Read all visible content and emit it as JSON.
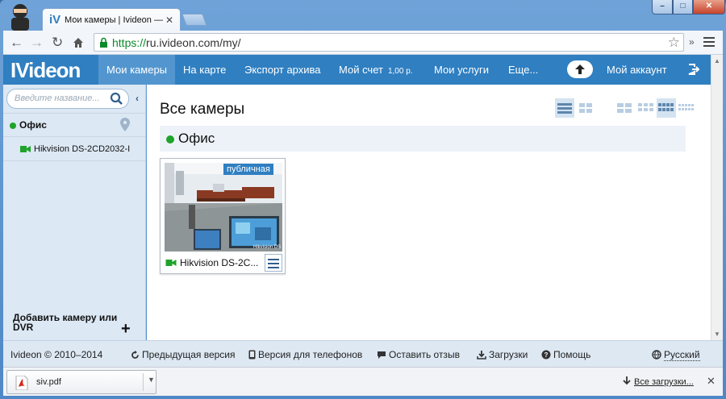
{
  "browser": {
    "tab_title": "Мои камеры | Ivideon —",
    "tab_logo": "iV",
    "tab_close": "✕",
    "url_scheme": "https://",
    "url_rest": "ru.ivideon.com/my/",
    "extensions_label": "»",
    "win_min": "–",
    "win_max": "□",
    "win_close": "✕"
  },
  "nav": {
    "logo": "IVideon",
    "items": [
      {
        "label": "Мои камеры",
        "active": true
      },
      {
        "label": "На карте"
      },
      {
        "label": "Экспорт архива"
      },
      {
        "label": "Мой счет",
        "extra": "1,00 р."
      },
      {
        "label": "Мои услуги"
      },
      {
        "label": "Еще..."
      }
    ],
    "account": "Мой аккаунт"
  },
  "sidebar": {
    "search_placeholder": "Введите название...",
    "collapse": "‹",
    "group_name": "Офис",
    "camera_name": "Hikvision DS-2CD2032-I",
    "add_camera": "Добавить камеру или DVR",
    "add_plus": "+"
  },
  "main": {
    "title": "Все камеры",
    "group_name": "Офис",
    "card": {
      "badge": "публичная",
      "name": "Hikvision DS-2C...",
      "overlay": "Hikvision DS"
    }
  },
  "footer": {
    "copyright": "Ivideon © 2010–2014",
    "prev_version": "Предыдущая версия",
    "mobile": "Версия для телефонов",
    "feedback": "Оставить отзыв",
    "downloads": "Загрузки",
    "help": "Помощь",
    "language": "Русский"
  },
  "download_bar": {
    "file": "siv.pdf",
    "all_downloads": "Все загрузки...",
    "close": "✕"
  },
  "colors": {
    "brand": "#2f7fc1",
    "online": "#1fa32a"
  }
}
